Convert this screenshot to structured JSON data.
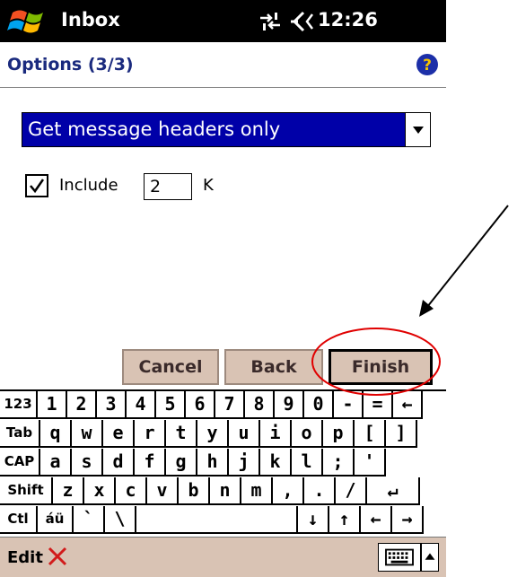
{
  "titlebar": {
    "app_title": "Inbox",
    "time": "12:26"
  },
  "header": {
    "title": "Options (3/3)"
  },
  "form": {
    "download_option": "Get message headers only",
    "include_label": "Include",
    "include_checked": true,
    "size_value": "2",
    "size_unit": "K"
  },
  "buttons": {
    "cancel": "Cancel",
    "back": "Back",
    "finish": "Finish"
  },
  "keyboard": {
    "rows": [
      [
        "123",
        "1",
        "2",
        "3",
        "4",
        "5",
        "6",
        "7",
        "8",
        "9",
        "0",
        "-",
        "=",
        "←"
      ],
      [
        "Tab",
        "q",
        "w",
        "e",
        "r",
        "t",
        "y",
        "u",
        "i",
        "o",
        "p",
        "[",
        "]"
      ],
      [
        "CAP",
        "a",
        "s",
        "d",
        "f",
        "g",
        "h",
        "j",
        "k",
        "l",
        ";",
        "'"
      ],
      [
        "Shift",
        "z",
        "x",
        "c",
        "v",
        "b",
        "n",
        "m",
        ",",
        ".",
        "/",
        "↵"
      ],
      [
        "Ctl",
        "áü",
        "`",
        "\\",
        "",
        "↓",
        "↑",
        "←",
        "→"
      ]
    ]
  },
  "menubar": {
    "edit": "Edit"
  },
  "colors": {
    "title_bg": "#000000",
    "header_text": "#1a2a7e",
    "selection": "#0000a8",
    "button_bg": "#d9c3b4",
    "annotation": "#e00000"
  }
}
